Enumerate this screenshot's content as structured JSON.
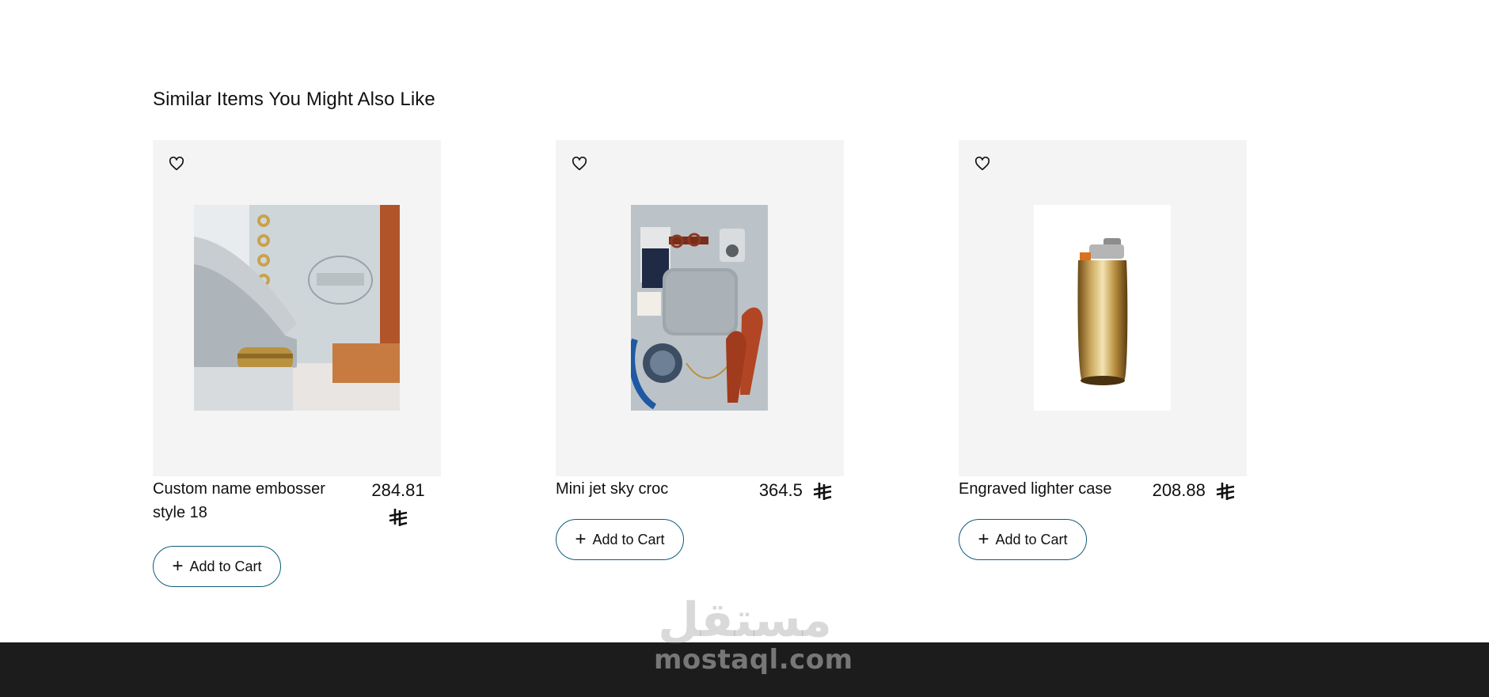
{
  "section": {
    "title": "Similar Items You Might Also Like"
  },
  "products": [
    {
      "name": "Custom name embosser style 18",
      "price": "284.81",
      "currency_icon": "saudi-riyal-icon",
      "image": "embosser-stamp-photo",
      "wishlist_icon": "heart-outline-icon",
      "add_to_cart_label": "Add to Cart"
    },
    {
      "name": "Mini jet sky croc",
      "price": "364.5",
      "currency_icon": "saudi-riyal-icon",
      "image": "travel-flatlay-photo",
      "wishlist_icon": "heart-outline-icon",
      "add_to_cart_label": "Add to Cart"
    },
    {
      "name": "Engraved lighter case",
      "price": "208.88",
      "currency_icon": "saudi-riyal-icon",
      "image": "gold-lighter-photo",
      "wishlist_icon": "heart-outline-icon",
      "add_to_cart_label": "Add to Cart"
    }
  ],
  "watermark": {
    "arabic": "مستقل",
    "site": "mostaql.com"
  },
  "colors": {
    "card_background": "#f4f4f4",
    "button_border": "#0f5b7a",
    "footer_background": "#1c1c1c",
    "text": "#111111"
  }
}
